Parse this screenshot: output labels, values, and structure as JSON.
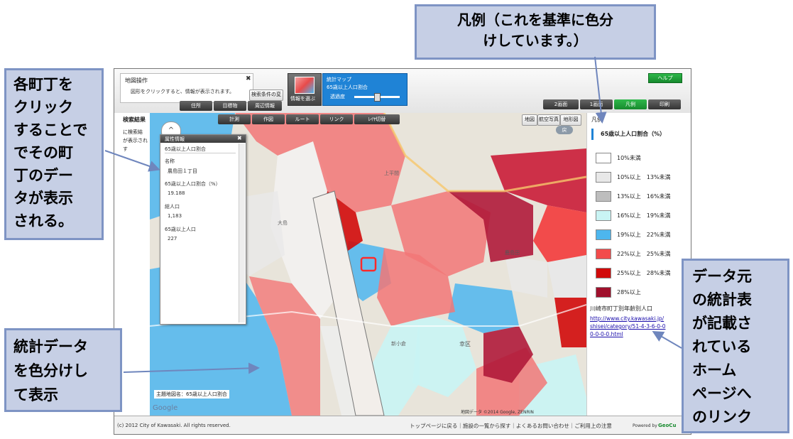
{
  "panel": {
    "title": "地図操作",
    "hint": "図形をクリックすると、情報が表示されます。",
    "search_condition_btn": "検索条件の変更",
    "btn_address": "住所",
    "btn_landmark": "目標物",
    "btn_nearby": "周辺情報"
  },
  "stat": {
    "select_btn": "情報を選ぶ",
    "title": "統計マップ",
    "subtitle": "65歳以上人口割合",
    "opacity_label": "透過度"
  },
  "header_right": {
    "help": "ヘルプ",
    "two_screen": "2画面",
    "one_screen": "1画面",
    "legend": "凡例",
    "print": "印刷"
  },
  "map_toolbar": {
    "search_results": "検索結果",
    "measure": "計測",
    "draw": "作図",
    "route": "ルート",
    "link": "リンク",
    "switch": "ﾚｲﾔ切替",
    "side_text_1": "に検索結",
    "side_text_2": "が表示され",
    "side_text_3": "す"
  },
  "map_types": [
    "地図",
    "航空写真",
    "地形図"
  ],
  "map_return": "戻",
  "attr_popup": {
    "title": "属性情報",
    "layer": "65歳以上人口割合",
    "name_label": "名称",
    "name_value": "農島田１丁目",
    "ratio_label": "65歳以上人口割合（%）",
    "ratio_value": "19.188",
    "total_label": "総人口",
    "total_value": "1,183",
    "elderly_label": "65歳以上人口",
    "elderly_value": "227"
  },
  "map_labels": {
    "theme_name": "主題地図名：65歳以上人口割合",
    "copyright_map": "地図データ ©2014 Google, ZENRIN",
    "google": "Google",
    "place_1": "上平間",
    "place_2": "大島",
    "place_3": "新小倉",
    "place_4": "幸区",
    "place_5": "鹿島田"
  },
  "legend": {
    "title": "凡例",
    "subtitle": "65歳以上人口割合（%）",
    "items": [
      {
        "label": "10%未満",
        "color": "#ffffff"
      },
      {
        "label": "10%以上　13%未満",
        "color": "#e8e8e8"
      },
      {
        "label": "13%以上　16%未満",
        "color": "#bdbdbd"
      },
      {
        "label": "16%以上　19%未満",
        "color": "#c9f4f4"
      },
      {
        "label": "19%以上　22%未満",
        "color": "#4db6ee"
      },
      {
        "label": "22%以上　25%未満",
        "color": "#f24b4b"
      },
      {
        "label": "25%以上　28%未満",
        "color": "#d10a0a"
      },
      {
        "label": "28%以上",
        "color": "#a0102c"
      }
    ],
    "source_title": "川崎市町丁別年齢別人口",
    "source_link_1": "http://www.city.kawasaki.jp/",
    "source_link_2": "shisei/category/51-4-3-6-0-0",
    "source_link_3": "0-0-0-0.html"
  },
  "footer": {
    "copyright": "(c) 2012 City of Kawasaki. All rights reserved.",
    "links": "トップページに戻る｜施設の一覧から探す｜よくあるお問い合わせ｜ご利用上の注意",
    "powered": "Powered by",
    "brand": "GeoCu"
  },
  "callouts": {
    "legend_note_1": "凡例（これを基準に色分",
    "legend_note_2": "けしています。）",
    "click_note": [
      "各町丁を",
      "クリック",
      "することで",
      "でその町",
      "丁のデー",
      "タが表示",
      "される。"
    ],
    "color_note": [
      "統計データ",
      "を色分けし",
      "て表示"
    ],
    "link_note": [
      "データ元",
      "の統計表",
      "が記載さ",
      "れている",
      "ホーム",
      "ページへ",
      "のリンク"
    ]
  }
}
